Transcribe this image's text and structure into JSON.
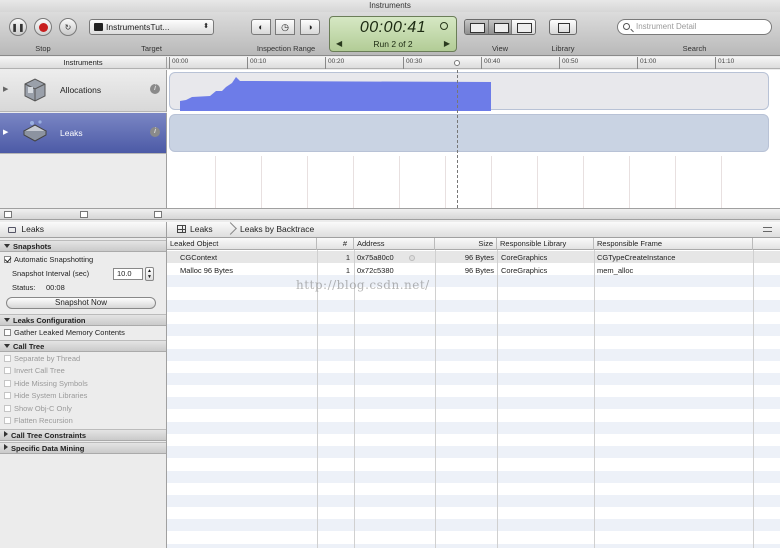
{
  "window": {
    "title": "Instruments"
  },
  "toolbar": {
    "stop_label": "Stop",
    "target_label": "Target",
    "target_value": "InstrumentsTut...",
    "inspection_range_label": "Inspection Range",
    "view_label": "View",
    "library_label": "Library",
    "search_label": "Search",
    "search_placeholder": "Instrument Detail"
  },
  "lcd": {
    "time": "00:00:41",
    "run": "Run 2 of 2"
  },
  "timeline": {
    "header": "Instruments",
    "ticks": [
      "00:00",
      "00:10",
      "00:20",
      "00:30",
      "00:40",
      "00:50",
      "01:00",
      "01:10"
    ]
  },
  "instruments": [
    {
      "name": "Allocations",
      "icon": "allocations-icon",
      "selected": false
    },
    {
      "name": "Leaks",
      "icon": "leaks-icon",
      "selected": true
    }
  ],
  "jumpbar": {
    "left": "Leaks",
    "crumb1": "Leaks",
    "crumb2": "Leaks by Backtrace"
  },
  "sidebar": {
    "snapshots": {
      "title": "Snapshots",
      "auto_label": "Automatic Snapshotting",
      "auto_checked": true,
      "interval_label": "Snapshot Interval (sec)",
      "interval_value": "10.0",
      "status_label": "Status:",
      "status_value": "00:08",
      "snapshot_button": "Snapshot Now"
    },
    "leaks_config": {
      "title": "Leaks Configuration",
      "gather_label": "Gather Leaked Memory Contents"
    },
    "call_tree": {
      "title": "Call Tree",
      "options": [
        "Separate by Thread",
        "Invert Call Tree",
        "Hide Missing Symbols",
        "Hide System Libraries",
        "Show Obj-C Only",
        "Flatten Recursion"
      ]
    },
    "constraints": {
      "title": "Call Tree Constraints"
    },
    "data_mining": {
      "title": "Specific Data Mining"
    }
  },
  "table": {
    "columns": [
      "Leaked Object",
      "#",
      "Address",
      "Size",
      "Responsible Library",
      "Responsible Frame"
    ],
    "rows": [
      {
        "object": "CGContext",
        "count": "1",
        "address": "0x75a80c0",
        "size": "96 Bytes",
        "library": "CoreGraphics",
        "frame": "CGTypeCreateInstance"
      },
      {
        "object": "Malloc 96 Bytes",
        "count": "1",
        "address": "0x72c5380",
        "size": "96 Bytes",
        "library": "CoreGraphics",
        "frame": "mem_alloc"
      }
    ]
  },
  "watermark": "http://blog.csdn.net/",
  "colors": {
    "selection": "#5a66b0",
    "allocation_graph": "#6d7ce8",
    "lcd": "#c6dcb0"
  }
}
